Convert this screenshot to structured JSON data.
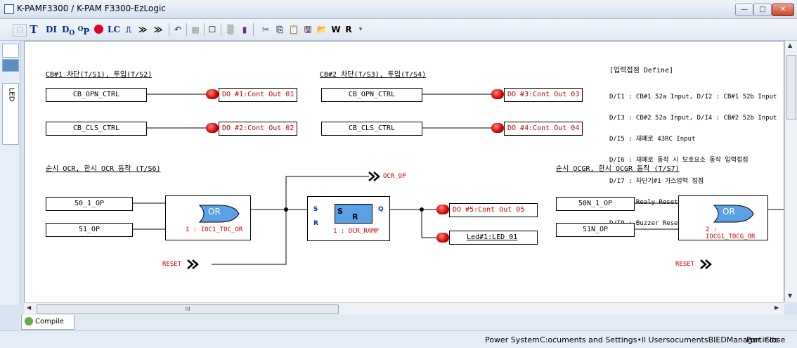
{
  "window": {
    "title": "K-PAMF3300 / K-PAM F3300-EzLogic"
  },
  "toolbar": {
    "tools": [
      "T",
      "DI",
      "D",
      "O",
      "O",
      "P",
      "LC",
      "W",
      "R"
    ]
  },
  "left_tabs": {
    "led": "LED"
  },
  "diagram": {
    "sections": {
      "cb1": "CB#1 차단(T/S1), 투입(T/S2)",
      "cb2": "CB#2 차단(T/S3), 투입(T/S4)",
      "ocr": "순시 OCR, 한시 OCR 동작 (T/S6)",
      "ocgr": "순시 OCGR, 한시 OCGR 동작 (T/S7)"
    },
    "define": {
      "title": "[입력접점 Define]",
      "lines": [
        "D/I1 : CB#1 52a Input, D/I2 : CB#1 52b Input",
        "D/I3 : CB#2 52a Input, D/I4 : CB#2 52b Input",
        "D/I5 : 재폐로 43RC Input",
        "D/I6 : 재폐로 동작 시 보호요소 동작 입력접점",
        "D/I7 : 차단기#1 가스압력 접점",
        "D/I8 : Realy Reset",
        "D/I9 : Buzzer Reset"
      ]
    },
    "inputs": {
      "cb_opn_1": "CB_OPN_CTRL",
      "cb_cls_1": "CB_CLS_CTRL",
      "cb_opn_2": "CB_OPN_CTRL",
      "cb_cls_2": "CB_CLS_CTRL",
      "op50": "50_1_OP",
      "op51": "51_OP",
      "op50n": "50N_1_OP",
      "op51n": "51N_OP"
    },
    "outputs": {
      "do1": "DO #1:Cont Out 01",
      "do2": "DO #2:Cont Out 02",
      "do3": "DO #3:Cont Out 03",
      "do4": "DO #4:Cont Out 04",
      "do5": "DO #5:Cont Out 05",
      "led1": "Led#1:LED 01"
    },
    "gates": {
      "or1_text": "OR",
      "or1_label": "1 : IOC1_TOC_OR",
      "or2_text": "OR",
      "or2_label": "2 : IOCG1_TOCG_OR",
      "sr_label": "1 : OCR_RAMP",
      "sr_s": "S",
      "sr_r": "R",
      "sr_q": "Q",
      "sr_inner_s": "S",
      "sr_inner_r": "R"
    },
    "signals": {
      "ocr_op": "OCR_OP",
      "reset1": "RESET",
      "reset2": "RESET"
    }
  },
  "hscroll": {
    "thumb_label": "III"
  },
  "bottom": {
    "compile_tab": "Compile"
  },
  "status": {
    "mode": "Power System",
    "path": "C:ocuments and Settings•ll UsersocumentsBIEDManager.ieds",
    "port": "Port Close"
  }
}
